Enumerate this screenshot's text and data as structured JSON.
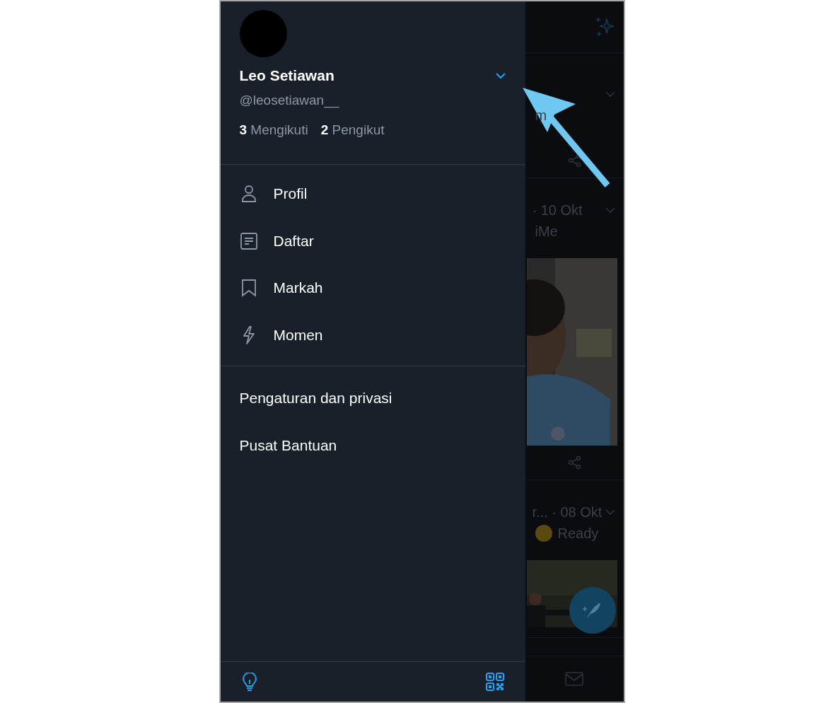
{
  "drawer": {
    "profile": {
      "name": "Leo Setiawan",
      "handle": "@leosetiawan__",
      "following_count": "3",
      "following_label": "Mengikuti",
      "followers_count": "2",
      "followers_label": "Pengikut"
    },
    "menu": [
      {
        "label": "Profil",
        "kind": "person"
      },
      {
        "label": "Daftar",
        "kind": "list"
      },
      {
        "label": "Markah",
        "kind": "bookmark"
      },
      {
        "label": "Momen",
        "kind": "bolt"
      }
    ],
    "secondary": [
      "Pengaturan dan privasi",
      "Pusat Bantuan"
    ]
  },
  "feed": {
    "tweets": [
      {
        "text": "m"
      },
      {
        "meta": "· 10 Okt",
        "text": "iMe"
      },
      {
        "meta": "r... · 08 Okt",
        "text": "Ready",
        "emoji": true
      }
    ]
  }
}
